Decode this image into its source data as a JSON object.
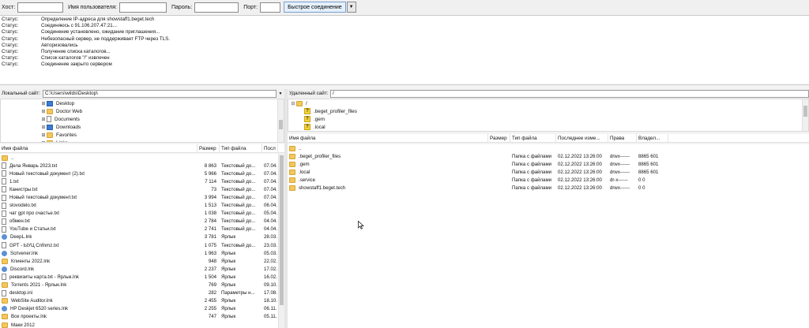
{
  "quickconnect": {
    "host_label": "Хост:",
    "user_label": "Имя пользователя:",
    "pass_label": "Пароль:",
    "port_label": "Порт:",
    "connect_label": "Быстрое соединение",
    "host_value": "",
    "user_value": "",
    "pass_value": "",
    "port_value": ""
  },
  "log": [
    {
      "status": "Статус:",
      "msg": "Определение IP-адреса для showstaff1.beget.tech"
    },
    {
      "status": "Статус:",
      "msg": "Соединяюсь с 91.106.207.47:21..."
    },
    {
      "status": "Статус:",
      "msg": "Соединение установлено, ожидание приглашения..."
    },
    {
      "status": "Статус:",
      "msg": "Небезопасный сервер, не поддерживает FTP через TLS."
    },
    {
      "status": "Статус:",
      "msg": "Авторизовались"
    },
    {
      "status": "Статус:",
      "msg": "Получение списка каталогов..."
    },
    {
      "status": "Статус:",
      "msg": "Список каталогов \"/\" извлечен"
    },
    {
      "status": "Статус:",
      "msg": "Соединение закрыто сервером"
    }
  ],
  "local": {
    "site_label": "Локальный сайт:",
    "path": "C:\\Users\\wilds\\Desktop\\",
    "tree": [
      {
        "name": "Desktop",
        "icon": "folder-blue"
      },
      {
        "name": "Doctor Web",
        "icon": "folder"
      },
      {
        "name": "Documents",
        "icon": "file"
      },
      {
        "name": "Downloads",
        "icon": "folder-blue"
      },
      {
        "name": "Favorites",
        "icon": "folder"
      },
      {
        "name": "Links",
        "icon": "folder"
      }
    ],
    "columns": [
      "Имя файла",
      "Размер",
      "Тип файла",
      "Посл"
    ],
    "files": [
      {
        "name": "..",
        "size": "",
        "type": "",
        "date": "",
        "icon": "folder"
      },
      {
        "name": "Дела Январь 2023.txt",
        "size": "8 863",
        "type": "Текстовый до...",
        "date": "07.04.",
        "icon": "file"
      },
      {
        "name": "Новый текстовый документ (2).txt",
        "size": "5 966",
        "type": "Текстовый до...",
        "date": "07.04.",
        "icon": "file"
      },
      {
        "name": "1.txt",
        "size": "7 114",
        "type": "Текстовый до...",
        "date": "07.04.",
        "icon": "file"
      },
      {
        "name": "Канистры.txt",
        "size": "73",
        "type": "Текстовый до...",
        "date": "07.04.",
        "icon": "file"
      },
      {
        "name": "Новый текстовый документ.txt",
        "size": "3 994",
        "type": "Текстовый до...",
        "date": "07.04.",
        "icon": "file"
      },
      {
        "name": "slovodelo.txt",
        "size": "1 513",
        "type": "Текстовый до...",
        "date": "06.04.",
        "icon": "file"
      },
      {
        "name": "чат gpt про счастье.txt",
        "size": "1 038",
        "type": "Текстовый до...",
        "date": "05.04.",
        "icon": "file"
      },
      {
        "name": "обмен.txt",
        "size": "2 784",
        "type": "Текстовый до...",
        "date": "04.04.",
        "icon": "file"
      },
      {
        "name": "YouTube и Статьи.txt",
        "size": "2 741",
        "type": "Текстовый до...",
        "date": "04.04.",
        "icon": "file"
      },
      {
        "name": "DeepL.lnk",
        "size": "3 781",
        "type": "Ярлык",
        "date": "28.03.",
        "icon": "lnk"
      },
      {
        "name": "GPT - ЫУЦ Cnfnmz.txt",
        "size": "1 075",
        "type": "Текстовый до...",
        "date": "23.03.",
        "icon": "file"
      },
      {
        "name": "Scrivener.lnk",
        "size": "1 963",
        "type": "Ярлык",
        "date": "05.03.",
        "icon": "lnk"
      },
      {
        "name": "Клиенты 2022.lnk",
        "size": "948",
        "type": "Ярлык",
        "date": "22.02.",
        "icon": "folder"
      },
      {
        "name": "Discord.lnk",
        "size": "2 237",
        "type": "Ярлык",
        "date": "17.02.",
        "icon": "lnk"
      },
      {
        "name": "реквизиты карта.txt - Ярлык.lnk",
        "size": "1 504",
        "type": "Ярлык",
        "date": "16.02.",
        "icon": "file"
      },
      {
        "name": "Torrents 2021 - Ярлык.lnk",
        "size": "769",
        "type": "Ярлык",
        "date": "09.10.",
        "icon": "folder"
      },
      {
        "name": "desktop.ini",
        "size": "282",
        "type": "Параметры н...",
        "date": "17.08.",
        "icon": "file"
      },
      {
        "name": "WebSite Auditor.lnk",
        "size": "2 455",
        "type": "Ярлык",
        "date": "18.10.",
        "icon": "folder"
      },
      {
        "name": "HP Deskjet 6520 series.lnk",
        "size": "2 255",
        "type": "Ярлык",
        "date": "06.11.",
        "icon": "lnk"
      },
      {
        "name": "Все проекты.lnk",
        "size": "747",
        "type": "Ярлык",
        "date": "05.11.",
        "icon": "folder"
      },
      {
        "name": "Маки 2012",
        "size": "",
        "type": "",
        "date": "",
        "icon": "folder"
      }
    ]
  },
  "remote": {
    "site_label": "Удаленный сайт:",
    "path": "/",
    "tree_root": "/",
    "tree": [
      {
        "name": ".beget_profiler_files"
      },
      {
        "name": ".gem"
      },
      {
        "name": ".local"
      }
    ],
    "columns": [
      "Имя файла",
      "Размер",
      "Тип файла",
      "Последнее изме...",
      "Права",
      "Владел..."
    ],
    "files": [
      {
        "name": "..",
        "size": "",
        "type": "",
        "modified": "",
        "perms": "",
        "owner": ""
      },
      {
        "name": ".beget_profiler_files",
        "size": "",
        "type": "Папка с файлами",
        "modified": "02.12.2022 13:26:00",
        "perms": "drwx------",
        "owner": "8865 601"
      },
      {
        "name": ".gem",
        "size": "",
        "type": "Папка с файлами",
        "modified": "02.12.2022 13:26:00",
        "perms": "drwx------",
        "owner": "8865 601"
      },
      {
        "name": ".local",
        "size": "",
        "type": "Папка с файлами",
        "modified": "02.12.2022 13:26:00",
        "perms": "drwx------",
        "owner": "8865 601"
      },
      {
        "name": ".service",
        "size": "",
        "type": "Папка с файлами",
        "modified": "02.12.2022 13:26:00",
        "perms": "dr-x------",
        "owner": "0 0"
      },
      {
        "name": "showstaff1.beget.tech",
        "size": "",
        "type": "Папка с файлами",
        "modified": "02.12.2022 13:26:00",
        "perms": "drwx------",
        "owner": "0 0"
      }
    ]
  }
}
